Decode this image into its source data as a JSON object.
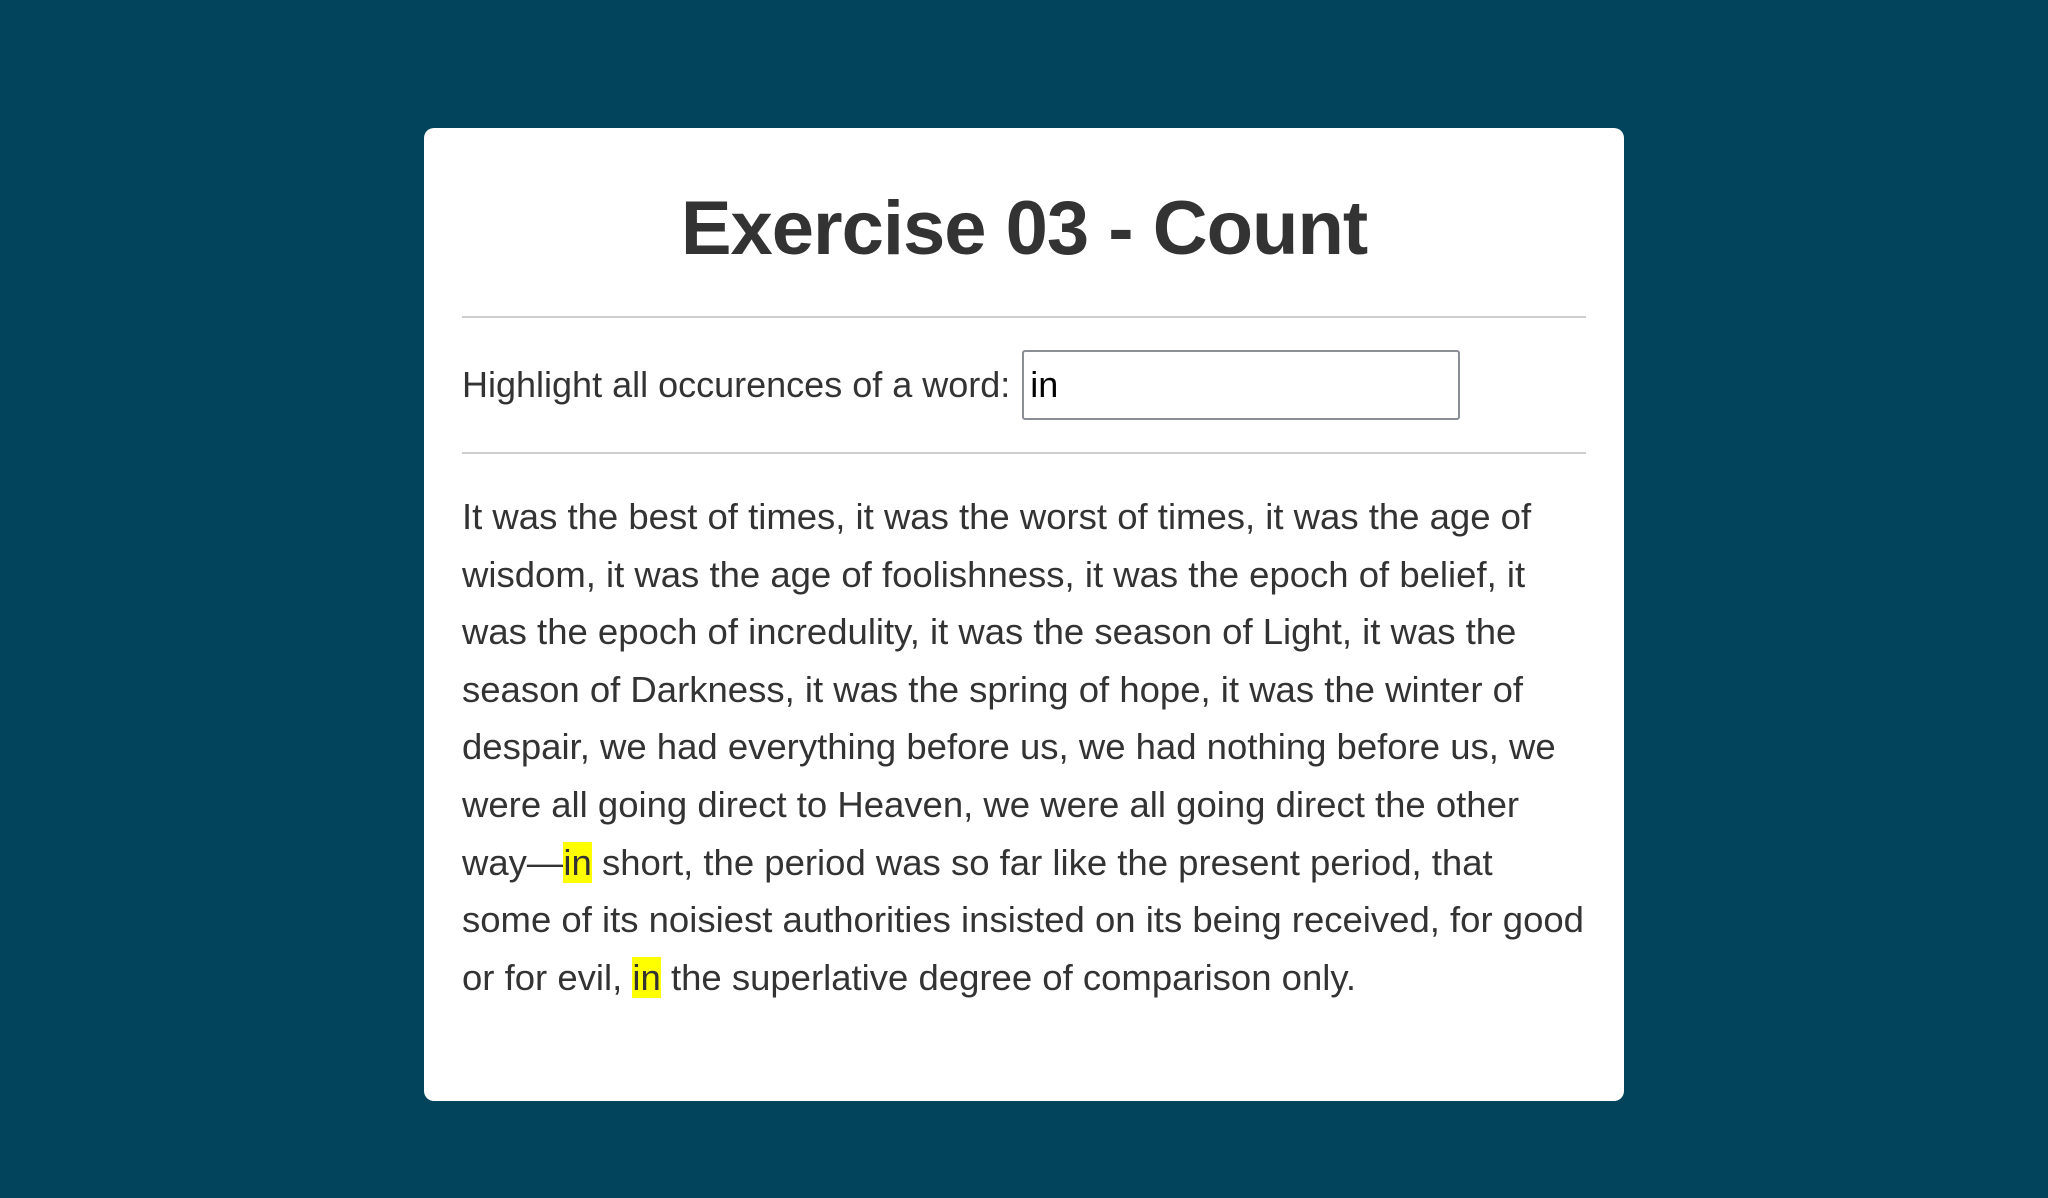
{
  "page": {
    "title": "Exercise 03 - Count"
  },
  "search": {
    "label": "Highlight all occurences of a word:",
    "value": "in",
    "placeholder": ""
  },
  "passage": {
    "segments": [
      "It was the best of times, it was the worst of times, it was the age of wisdom, it was the age of foolishness, it was the epoch of belief, it was the epoch of incredulity, it was the season of Light, it was the season of Darkness, it was the spring of hope, it was the winter of despair, we had everything before us, we had nothing before us, we were all going direct to Heaven, we were all going direct the other way—",
      "in",
      " short, the period was so far like the present period, that some of its noisiest authorities insisted on its being received, for good or for evil, ",
      "in",
      " the superlative degree of comparison only."
    ]
  },
  "colors": {
    "background": "#02445c",
    "card": "#ffffff",
    "highlight": "#ffff00",
    "text": "#333333"
  }
}
